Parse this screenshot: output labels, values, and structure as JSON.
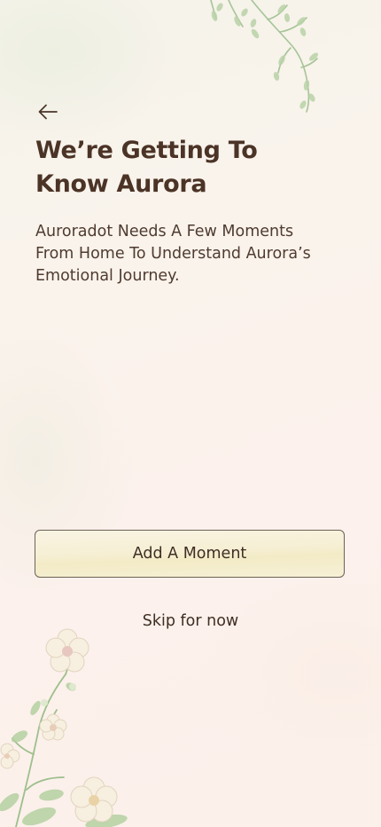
{
  "header": {
    "back_icon": "arrow-left-icon"
  },
  "intro": {
    "title_line1": "We’re Getting To",
    "title_line2": "Know Aurora",
    "desc_line1": "Auroradot Needs A Few Moments",
    "desc_line2": "From Home To Understand Aurora’s",
    "desc_line3": "Emotional Journey."
  },
  "actions": {
    "primary_label": "Add A Moment",
    "secondary_label": "Skip for now"
  },
  "decor": {
    "top_icon": "leafy-branch-icon",
    "bottom_icon": "flower-branch-icon"
  },
  "colors": {
    "text_primary": "#4b3326",
    "button_fill": "#f6efd4",
    "button_border": "#6e6155",
    "leaf_green": "#a9c79a",
    "flower_cream": "#f5ecdc"
  }
}
